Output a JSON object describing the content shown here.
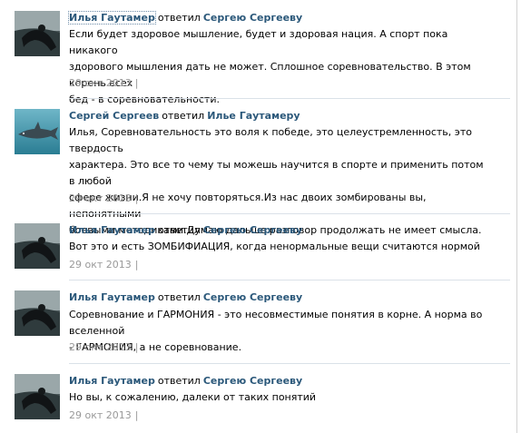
{
  "comments": [
    {
      "author": "Илья Гаутамер",
      "verb": "ответил",
      "reply_to": "Сергею Сергееву",
      "lines": [
        "Если будет здоровое мышление, будет и здоровая нация. А спорт пока никакого",
        "здорового мышления дать не может. Сплошное соревновательство. В этом корень всех",
        "бед - в соревновательности."
      ],
      "date": "29 окт 2013",
      "separator": "|",
      "avatar": "skydiver-photo"
    },
    {
      "author": "Сергей Сергеев",
      "verb": "ответил",
      "reply_to": "Илье Гаутамеру",
      "lines": [
        "Илья, Соревновательность это воля к победе, это целеустремленность, это твердость",
        "характера. Это все то чему ты можешь научится в спорте и применить потом в любой",
        "сфере жизни.Я не хочу повторяться.Из нас двоих зомбированы вы, непонятными",
        "боевыми методиками.Думаю дальше разговор продолжать не имеет смысла."
      ],
      "date": "29 окт 2013",
      "separator": "|",
      "avatar": "shark-photo"
    },
    {
      "author": "Илья Гаутамер",
      "verb": "ответил",
      "reply_to": "Сергею Сергееву",
      "lines": [
        "Вот это и есть ЗОМБИФИАЦИЯ, когда ненормальные вещи считаются нормой"
      ],
      "date": "29 окт 2013",
      "separator": "|",
      "avatar": "skydiver-photo"
    },
    {
      "author": "Илья Гаутамер",
      "verb": "ответил",
      "reply_to": "Сергею Сергееву",
      "lines": [
        "Соревнование и ГАРМОНИЯ - это несовместимые понятия в корне. А норма во вселенной",
        "- ГАРМОНИЯ, а не соревнование."
      ],
      "date": "29 окт 2013",
      "separator": "|",
      "avatar": "skydiver-photo"
    },
    {
      "author": "Илья Гаутамер",
      "verb": "ответил",
      "reply_to": "Сергею Сергееву",
      "lines": [
        "Но вы, к сожалению, далеки от таких понятий"
      ],
      "date": "29 окт 2013",
      "separator": "|",
      "avatar": "skydiver-photo"
    }
  ],
  "colors": {
    "link": "#2b587a",
    "meta": "#999999",
    "separator": "#dae1e8"
  }
}
